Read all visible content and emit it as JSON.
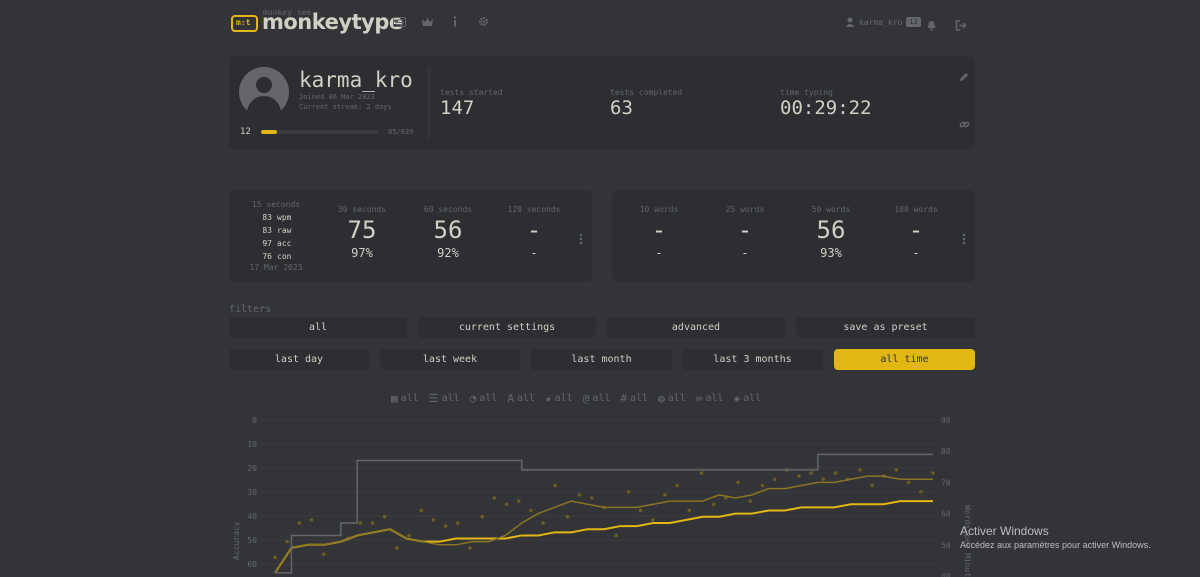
{
  "header": {
    "logo_small": "monkey see",
    "logo_icon_text": "m:t",
    "title": "monkeytype",
    "nav_icons": [
      "keyboard-icon",
      "crown-icon",
      "info-icon",
      "gear-icon"
    ],
    "username": "karma_kro",
    "user_level": "12"
  },
  "profile": {
    "username": "karma_kro",
    "joined": "Joined 06 Mar 2023",
    "streak": "Current streak: 2 days",
    "level": "12",
    "xp_progress": 0.133,
    "xp_text": "85/639",
    "stats": [
      {
        "label": "tests started",
        "value": "147"
      },
      {
        "label": "tests completed",
        "value": "63"
      },
      {
        "label": "time typing",
        "value": "00:29:22"
      }
    ]
  },
  "pb_time": {
    "hover": {
      "label": "15 seconds",
      "rows": [
        {
          "v": "83",
          "k": "wpm"
        },
        {
          "v": "83",
          "k": "raw"
        },
        {
          "v": "97",
          "k": "acc"
        },
        {
          "v": "76",
          "k": "con"
        }
      ],
      "date": "17 Mar 2023"
    },
    "items": [
      {
        "label": "30 seconds",
        "wpm": "75",
        "acc": "97%"
      },
      {
        "label": "60 seconds",
        "wpm": "56",
        "acc": "92%"
      },
      {
        "label": "120 seconds",
        "wpm": "-",
        "acc": "-"
      }
    ]
  },
  "pb_words": {
    "items": [
      {
        "label": "10 words",
        "wpm": "-",
        "acc": "-"
      },
      {
        "label": "25 words",
        "wpm": "-",
        "acc": "-"
      },
      {
        "label": "50 words",
        "wpm": "56",
        "acc": "93%"
      },
      {
        "label": "100 words",
        "wpm": "-",
        "acc": "-"
      }
    ]
  },
  "filters": {
    "label": "filters",
    "row1": [
      "all",
      "current settings",
      "advanced",
      "save as preset"
    ],
    "row2": [
      "last day",
      "last week",
      "last month",
      "last 3 months",
      "all time"
    ],
    "active": "all time",
    "chips": [
      {
        "icon": "calendar-icon",
        "glyph": "▦",
        "label": "all"
      },
      {
        "icon": "list-icon",
        "glyph": "☰",
        "label": "all"
      },
      {
        "icon": "clock-icon",
        "glyph": "◔",
        "label": "all"
      },
      {
        "icon": "font-icon",
        "glyph": "A",
        "label": "all"
      },
      {
        "icon": "star-icon",
        "glyph": "★",
        "label": "all"
      },
      {
        "icon": "at-icon",
        "glyph": "@",
        "label": "all"
      },
      {
        "icon": "hashtag-icon",
        "glyph": "#",
        "label": "all"
      },
      {
        "icon": "globe-icon",
        "glyph": "◍",
        "label": "all"
      },
      {
        "icon": "infinity-icon",
        "glyph": "∞",
        "label": "all"
      },
      {
        "icon": "tags-icon",
        "glyph": "◈",
        "label": "all"
      }
    ]
  },
  "chart_data": {
    "type": "line",
    "left_axis": {
      "label": "Accuracy",
      "ticks": [
        "0",
        "10",
        "20",
        "30",
        "40",
        "50",
        "60"
      ]
    },
    "right_axis": {
      "label": "Words per Minute",
      "ticks": [
        "90",
        "80",
        "70",
        "60",
        "50",
        "40"
      ]
    },
    "series": [
      {
        "color": "#e2b714",
        "style": "wpm-average",
        "values": [
          41,
          49,
          50,
          50,
          51,
          53,
          54,
          55,
          52,
          51,
          51,
          52,
          52,
          52,
          52,
          53,
          53,
          54,
          54,
          55,
          55,
          56,
          56,
          57,
          57,
          58,
          59,
          59,
          60,
          60,
          61,
          61,
          62,
          62,
          62,
          63,
          63,
          63,
          64,
          64,
          64
        ]
      },
      {
        "color": "#8a7524",
        "style": "accuracy-average",
        "values": [
          41,
          49,
          50,
          50,
          51,
          53,
          54,
          55,
          52,
          51,
          50,
          50,
          51,
          51,
          53,
          57,
          60,
          62,
          64,
          63,
          62,
          62,
          62,
          63,
          64,
          64,
          64,
          66,
          65,
          66,
          68,
          68,
          69,
          70,
          70,
          71,
          72,
          72,
          71,
          71,
          71
        ]
      },
      {
        "color": "#646669",
        "style": "personal-best",
        "values": [
          41,
          53,
          53,
          53,
          57,
          77,
          77,
          77,
          77,
          77,
          77,
          77,
          77,
          77,
          77,
          74,
          74,
          74,
          74,
          74,
          74,
          74,
          74,
          74,
          74,
          74,
          74,
          74,
          74,
          74,
          74,
          74,
          74,
          79,
          79,
          79,
          79,
          79,
          79,
          79,
          79
        ]
      }
    ],
    "scatter": [
      46,
      51,
      57,
      58,
      47,
      39,
      52,
      57,
      57,
      59,
      49,
      53,
      61,
      58,
      56,
      57,
      49,
      59,
      65,
      63,
      64,
      61,
      57,
      69,
      59,
      66,
      65,
      62,
      53,
      67,
      61,
      58,
      66,
      69,
      61,
      73,
      63,
      65,
      70,
      64,
      69,
      71,
      74,
      72,
      73,
      71,
      73,
      71,
      74,
      69,
      72,
      74,
      70,
      67,
      73
    ],
    "y_range_wpm": [
      40,
      90
    ]
  },
  "watermark": {
    "title": "Activer Windows",
    "subtitle": "Accédez aux paramètres pour activer Windows."
  }
}
